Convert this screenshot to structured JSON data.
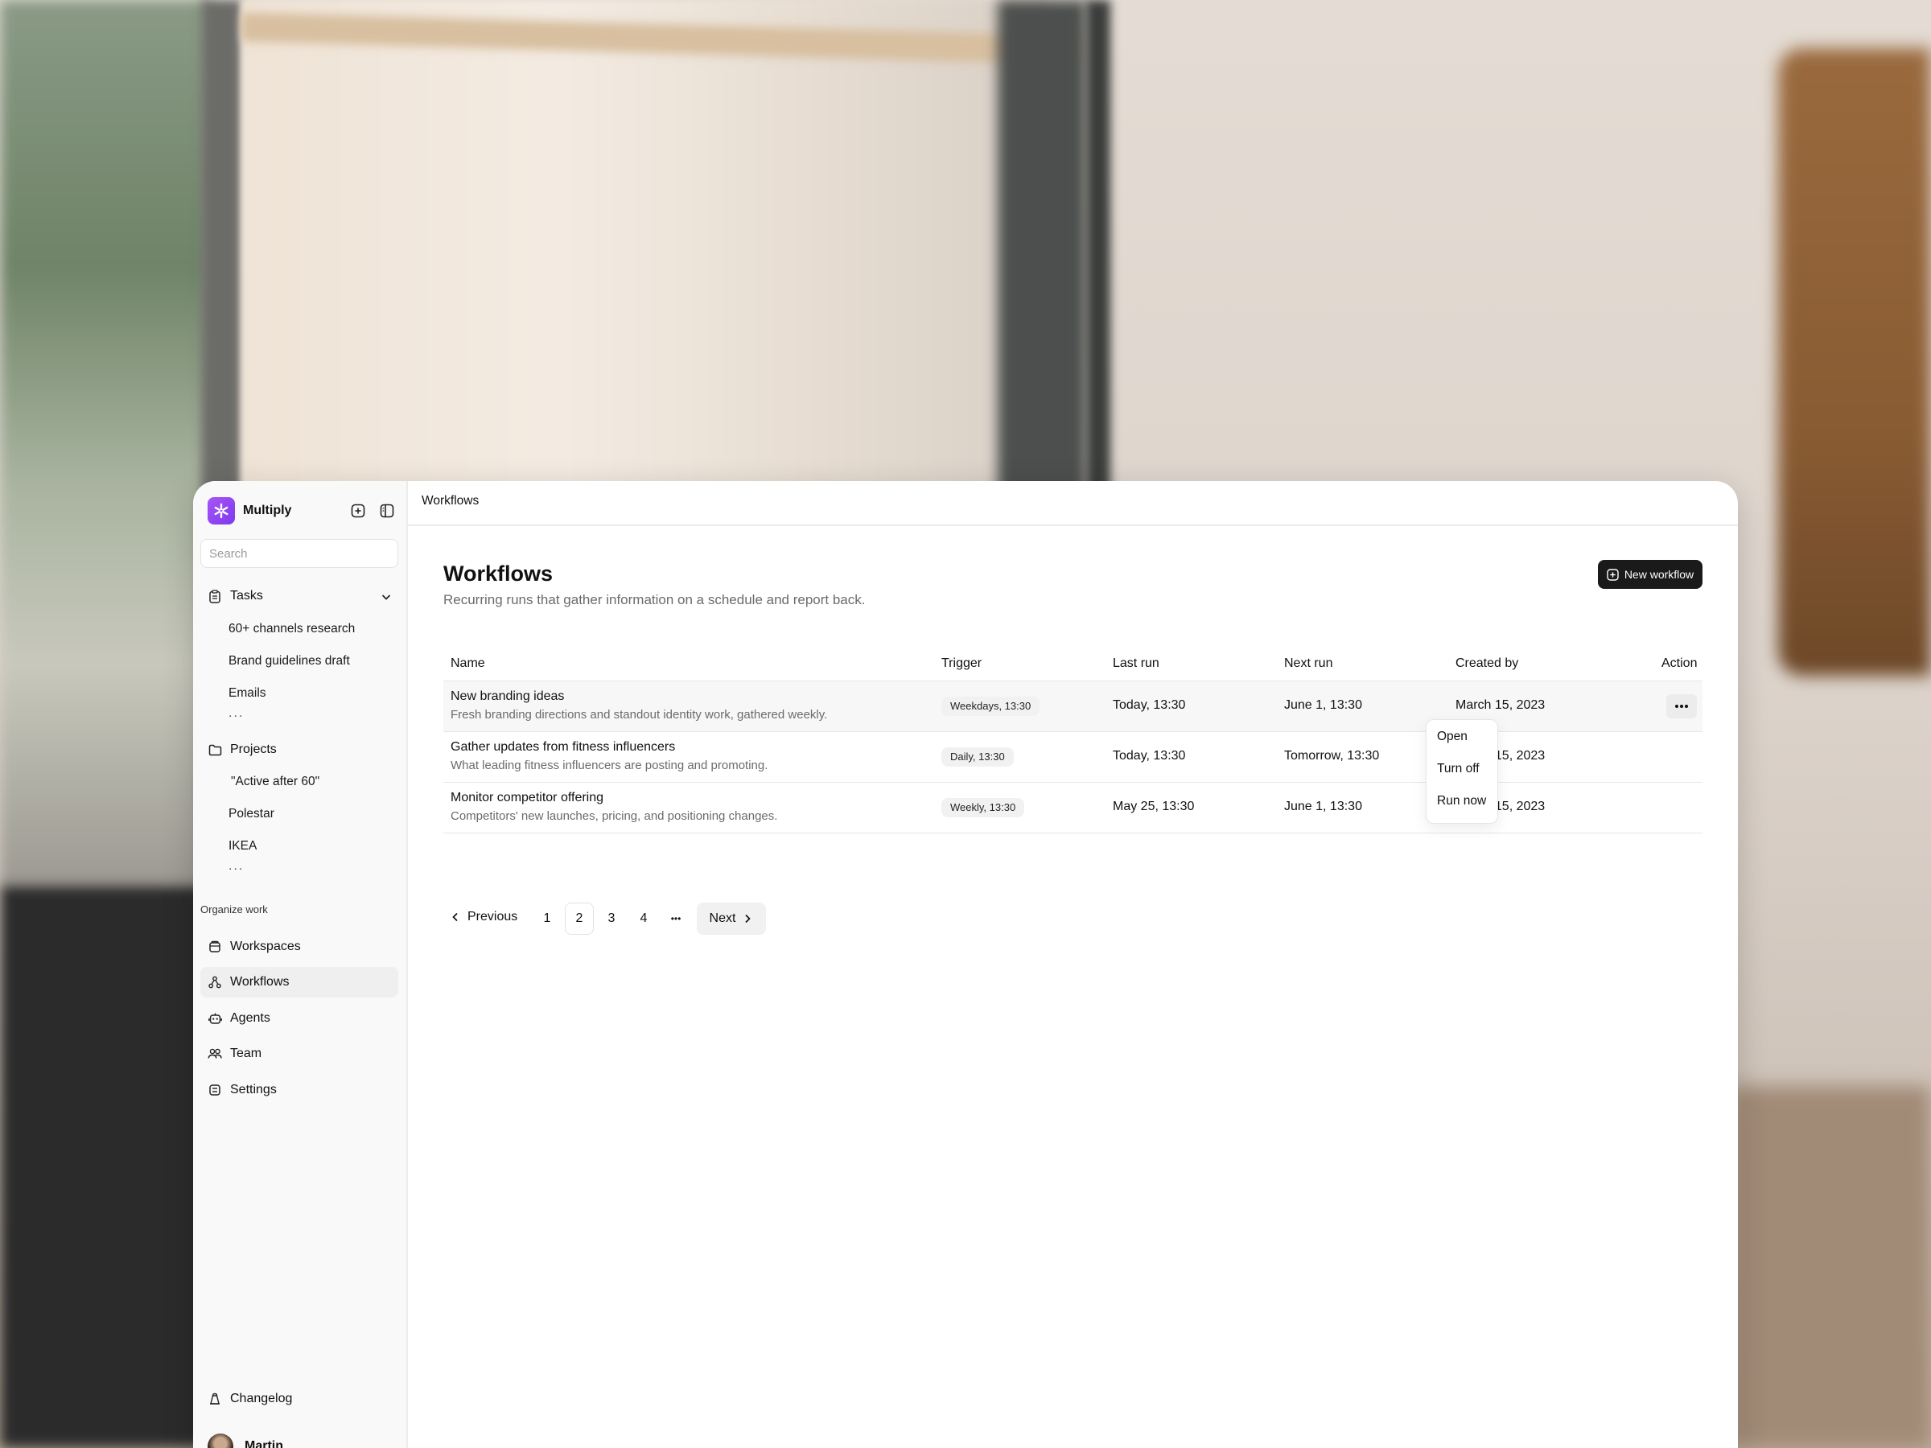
{
  "app": {
    "name": "Multiply"
  },
  "sidebar": {
    "search_placeholder": "Search",
    "tasks": {
      "label": "Tasks",
      "items": [
        "60+ channels research",
        "Brand guidelines draft",
        "Emails"
      ],
      "more": "..."
    },
    "projects": {
      "label": "Projects",
      "items": [
        "\"Active after 60\"",
        "Polestar",
        "IKEA"
      ],
      "more": "..."
    },
    "organize_label": "Organize work",
    "nav": [
      {
        "label": "Workspaces",
        "icon": "workspaces-icon"
      },
      {
        "label": "Workflows",
        "icon": "workflows-icon",
        "active": true
      },
      {
        "label": "Agents",
        "icon": "agents-icon"
      },
      {
        "label": "Team",
        "icon": "team-icon"
      },
      {
        "label": "Settings",
        "icon": "settings-icon"
      }
    ],
    "changelog": "Changelog",
    "user": "Martin"
  },
  "header": {
    "breadcrumb": "Workflows"
  },
  "page": {
    "title": "Workflows",
    "subtitle": "Recurring runs that gather information on a schedule and report back.",
    "new_button": "New workflow"
  },
  "table": {
    "columns": [
      "Name",
      "Trigger",
      "Last run",
      "Next run",
      "Created by",
      "Action"
    ],
    "rows": [
      {
        "name": "New branding ideas",
        "desc": "Fresh branding directions and standout identity work, gathered weekly.",
        "trigger": "Weekdays, 13:30",
        "last_run": "Today, 13:30",
        "next_run": "June 1, 13:30",
        "created_by": "March 15, 2023"
      },
      {
        "name": "Gather updates from fitness influencers",
        "desc": "What leading fitness influencers are posting and promoting.",
        "trigger": "Daily, 13:30",
        "last_run": "Today, 13:30",
        "next_run": "Tomorrow, 13:30",
        "created_by": "March 15, 2023"
      },
      {
        "name": "Monitor competitor offering",
        "desc": "Competitors' new launches, pricing, and positioning changes.",
        "trigger": "Weekly, 13:30",
        "last_run": "May 25, 13:30",
        "next_run": "June 1, 13:30",
        "created_by": "March 15, 2023"
      }
    ]
  },
  "action_menu": {
    "items": [
      "Open",
      "Turn off",
      "Run now"
    ]
  },
  "pagination": {
    "previous": "Previous",
    "pages": [
      "1",
      "2",
      "3",
      "4"
    ],
    "current": "2",
    "ellipsis": "•••",
    "next": "Next"
  },
  "colors": {
    "accent": "#8b5cf6",
    "primary_button": "#1a1a1a",
    "sidebar_bg": "#f9f9f9"
  }
}
